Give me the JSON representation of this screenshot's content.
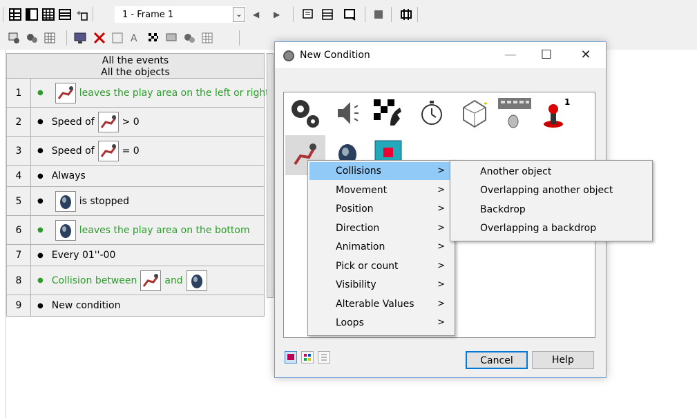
{
  "toolbar": {
    "frame_selector": "1 - Frame 1"
  },
  "events": {
    "header_line1": "All the events",
    "header_line2": "All the objects",
    "rows": [
      {
        "num": "1",
        "pre": "",
        "post": "leaves the play area on the left or right",
        "green": true
      },
      {
        "num": "2",
        "pre": "Speed of",
        "post": "> 0",
        "green": false
      },
      {
        "num": "3",
        "pre": "Speed of",
        "post": "= 0",
        "green": false
      },
      {
        "num": "4",
        "pre": "Always",
        "post": "",
        "green": false
      },
      {
        "num": "5",
        "pre": "",
        "post": "is stopped",
        "green": false
      },
      {
        "num": "6",
        "pre": "",
        "post": "leaves the play area on the bottom",
        "green": true
      },
      {
        "num": "7",
        "pre": "Every 01''-00",
        "post": "",
        "green": false
      },
      {
        "num": "8",
        "pre": "Collision between",
        "mid": "and",
        "post": "",
        "green": true
      },
      {
        "num": "9",
        "pre": "New condition",
        "post": "",
        "green": false
      }
    ]
  },
  "dialog": {
    "title": "New Condition",
    "buttons": {
      "cancel": "Cancel",
      "help": "Help"
    },
    "joystick_badge": "1"
  },
  "menu": {
    "items": [
      "Collisions",
      "Movement",
      "Position",
      "Direction",
      "Animation",
      "Pick or count",
      "Visibility",
      "Alterable Values",
      "Loops"
    ],
    "submenu": [
      "Another object",
      "Overlapping another object",
      "Backdrop",
      "Overlapping a backdrop"
    ],
    "chevron": ">"
  },
  "colors": {
    "accent": "#0078d7",
    "highlight": "#91c9f7",
    "green_text": "#2a9d2a"
  }
}
